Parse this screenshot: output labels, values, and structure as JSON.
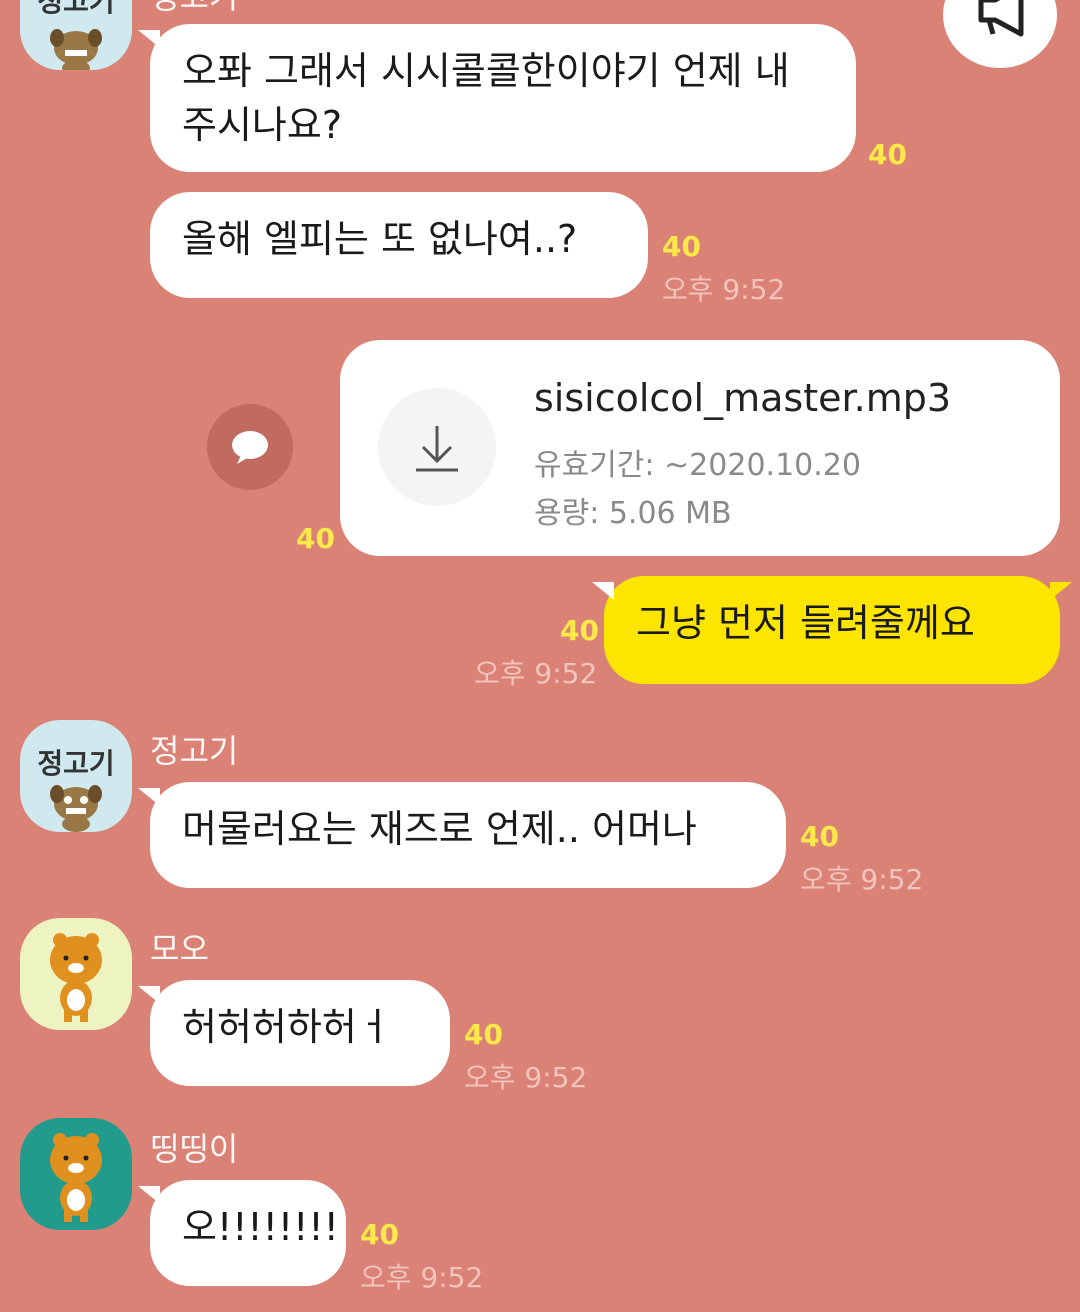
{
  "top_partial": {
    "avatar_label": "정고기",
    "sender": "정고기"
  },
  "messages": [
    {
      "text": "오퐈 그래서 시시콜콜한이야기 언제 내주시나요?",
      "count": "40"
    },
    {
      "text": "올해 엘피는 또 없나여..?",
      "count": "40",
      "time": "오후 9:52"
    }
  ],
  "file_message": {
    "filename": "sisicolcol_master.mp3",
    "expiry_label": "유효기간: ~2020.10.20",
    "size_label": "용량: 5.06 MB",
    "count": "40",
    "icons": {
      "download": "download-icon",
      "share": "speech-bubble-icon"
    }
  },
  "my_message": {
    "text": "그냥 먼저 들려줄께요",
    "count": "40",
    "time": "오후 9:52"
  },
  "chats": [
    {
      "sender": "정고기",
      "avatar_label": "정고기",
      "text": "머물러요는 재즈로 언제.. 어머나",
      "count": "40",
      "time": "오후 9:52"
    },
    {
      "sender": "모오",
      "text": "허허허하허ㅓ",
      "count": "40",
      "time": "오후 9:52"
    },
    {
      "sender": "띵띵이",
      "text": "오!!!!!!!!",
      "count": "40",
      "time": "오후 9:52"
    }
  ],
  "colors": {
    "background": "#d98275",
    "my_bubble": "#fee500",
    "unread_count": "#ffe94a"
  }
}
